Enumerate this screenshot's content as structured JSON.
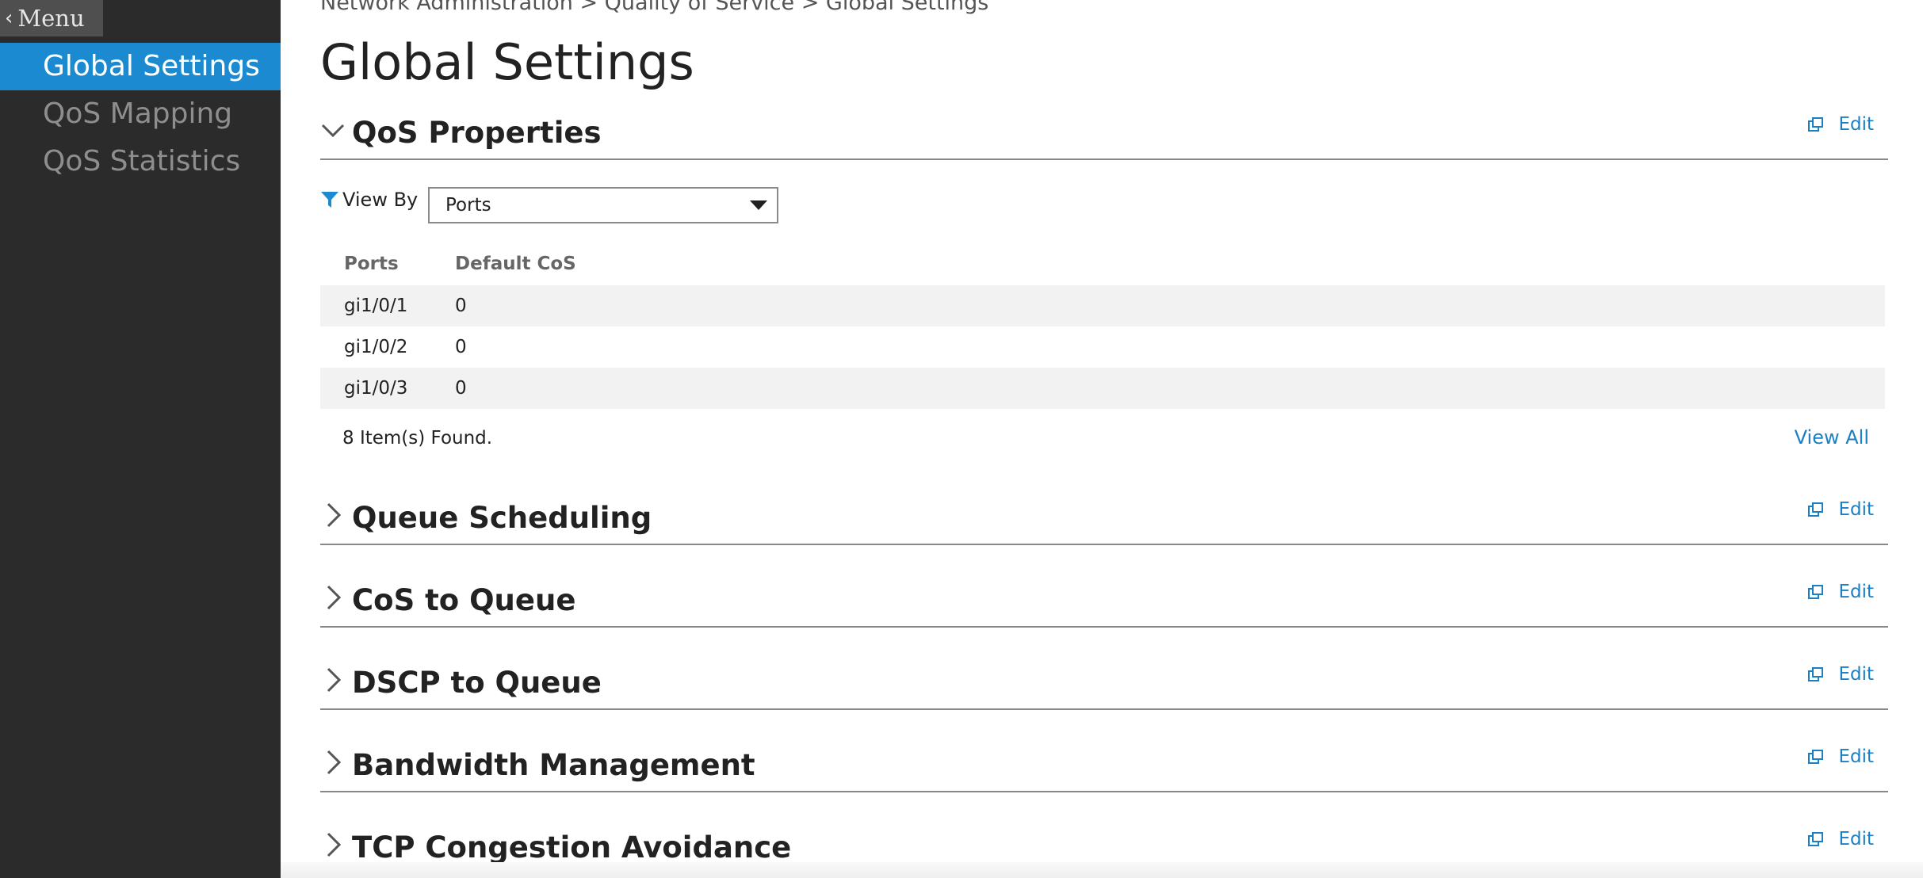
{
  "sidebar": {
    "menu_label": "Menu",
    "items": [
      {
        "label": "Global Settings",
        "active": true
      },
      {
        "label": "QoS Mapping",
        "active": false
      },
      {
        "label": "QoS Statistics",
        "active": false
      }
    ]
  },
  "breadcrumb": "Network Administration > Quality of Service > Global Settings",
  "page_title": "Global Settings",
  "edit_label": "Edit",
  "sections": [
    {
      "title": "QoS Properties",
      "expanded": true
    },
    {
      "title": "Queue Scheduling",
      "expanded": false
    },
    {
      "title": "CoS to Queue",
      "expanded": false
    },
    {
      "title": "DSCP to Queue",
      "expanded": false
    },
    {
      "title": "Bandwidth Management",
      "expanded": false
    },
    {
      "title": "TCP Congestion Avoidance",
      "expanded": false
    }
  ],
  "qos_properties": {
    "view_by_label": "View By",
    "view_by_selected": "Ports",
    "columns": [
      "Ports",
      "Default CoS"
    ],
    "rows": [
      [
        "gi1/0/1",
        "0"
      ],
      [
        "gi1/0/2",
        "0"
      ],
      [
        "gi1/0/3",
        "0"
      ]
    ],
    "items_found": "8 Item(s) Found.",
    "view_all_label": "View All"
  },
  "colors": {
    "accent": "#1b8ad1",
    "link": "#1a7fc5",
    "sidebar_bg": "#2b2b2b"
  }
}
